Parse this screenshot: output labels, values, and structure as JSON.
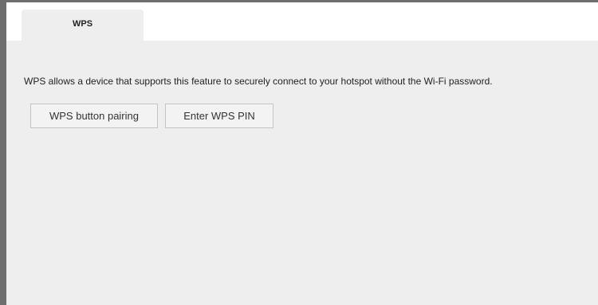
{
  "tabs": [
    {
      "label": "WPS",
      "active": true
    }
  ],
  "main": {
    "description": "WPS allows a device that supports this feature to securely connect to your hotspot without the Wi-Fi password.",
    "buttons": {
      "pairing_label": "WPS button pairing",
      "pin_label": "Enter WPS PIN"
    }
  },
  "colors": {
    "frame_border": "#6e6e6e",
    "panel_background": "#eeeeee",
    "button_background": "#f3f3f3"
  }
}
